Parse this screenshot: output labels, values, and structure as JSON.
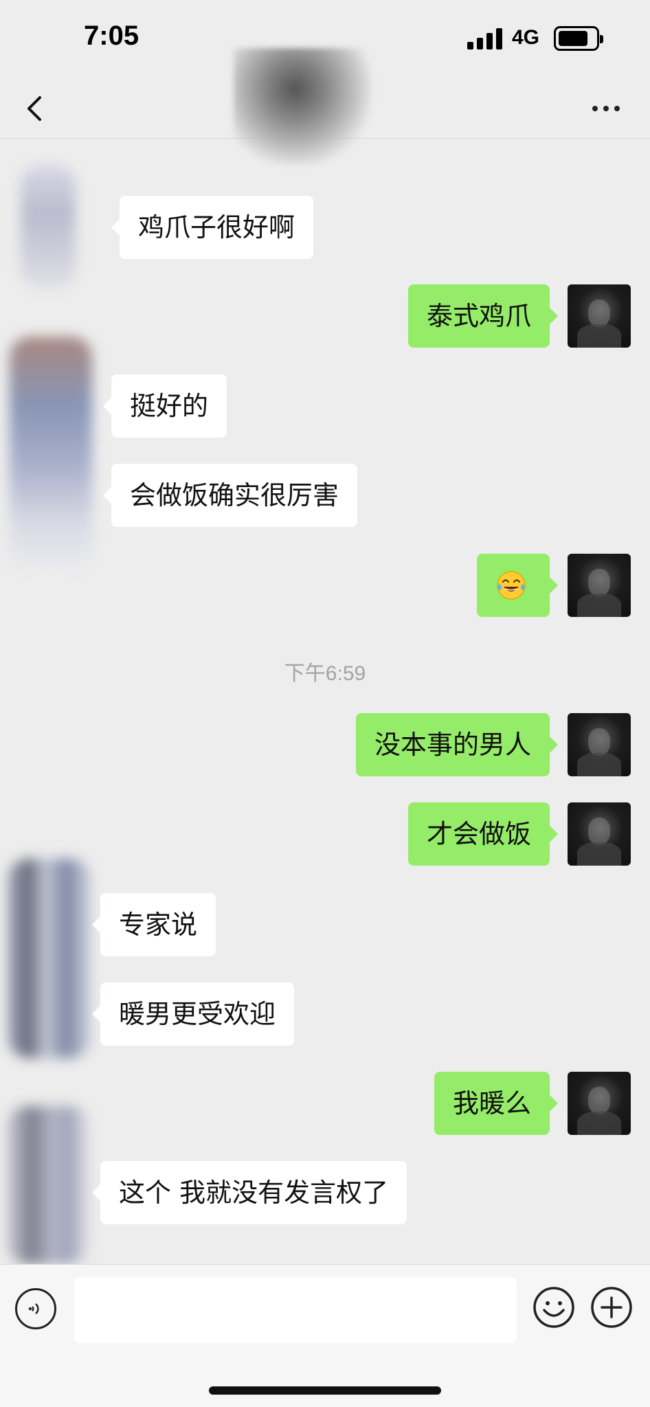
{
  "status_bar": {
    "time": "7:05",
    "network": "4G",
    "battery_level": 0.75
  },
  "nav": {
    "back_icon": "chevron-left-icon",
    "more_icon": "more-dots-icon"
  },
  "messages": [
    {
      "side": "in",
      "text": "鸡爪子很好啊"
    },
    {
      "side": "out",
      "text": "泰式鸡爪"
    },
    {
      "side": "in",
      "text": "挺好的"
    },
    {
      "side": "in",
      "text": "会做饭确实很厉害"
    },
    {
      "side": "out",
      "text": "",
      "emoji": "tears-of-joy-emoji"
    },
    {
      "side": "out",
      "text": "没本事的男人"
    },
    {
      "side": "out",
      "text": "才会做饭"
    },
    {
      "side": "in",
      "text": "专家说"
    },
    {
      "side": "in",
      "text": "暖男更受欢迎"
    },
    {
      "side": "out",
      "text": "我暖么"
    },
    {
      "side": "in",
      "text": "这个 我就没有发言权了"
    }
  ],
  "timestamp": "下午6:59",
  "input_bar": {
    "voice_icon": "voice-icon",
    "emoji_icon": "emoji-icon",
    "plus_icon": "plus-icon",
    "placeholder": ""
  },
  "colors": {
    "background": "#ededed",
    "outgoing_bubble": "#95ec69",
    "incoming_bubble": "#ffffff",
    "timestamp_text": "#a3a3a3"
  }
}
